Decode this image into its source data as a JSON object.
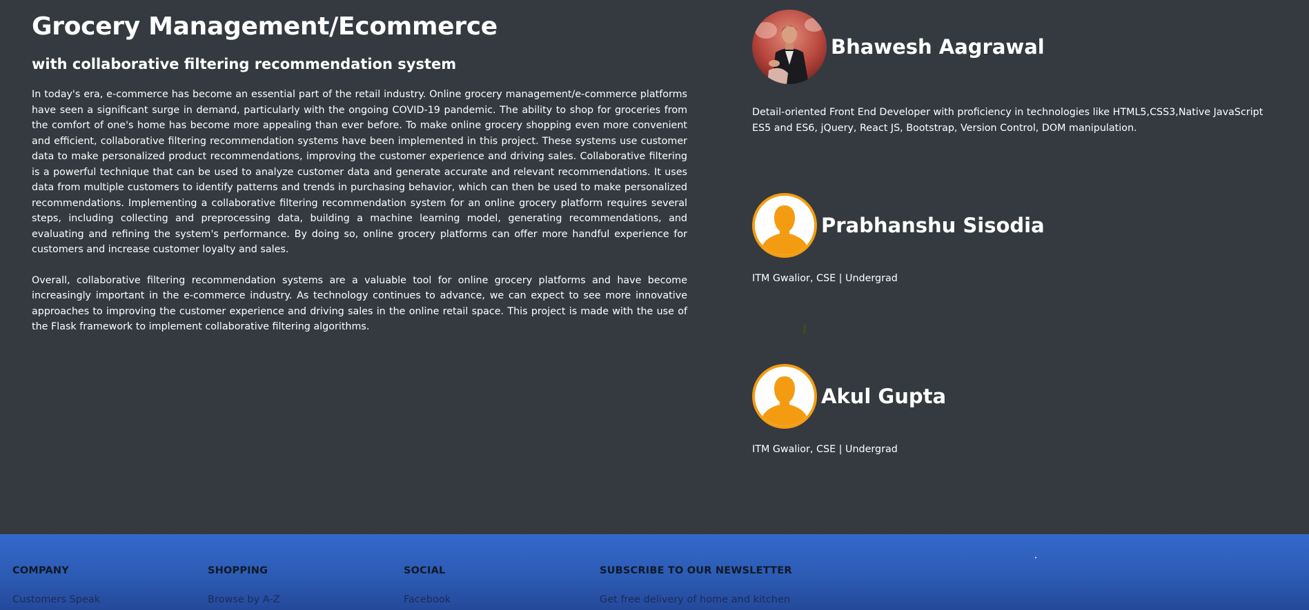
{
  "intro": {
    "title": "Grocery Management/Ecommerce",
    "subtitle": "with collaborative filtering recommendation system",
    "paragraph1": "In today's era, e-commerce has become an essential part of the retail industry. Online grocery management/e-commerce platforms have seen a significant surge in demand, particularly with the ongoing COVID-19 pandemic. The ability to shop for groceries from the comfort of one's home has become more appealing than ever before. To make online grocery shopping even more convenient and efficient, collaborative filtering recommendation systems have been implemented in this project. These systems use customer data to make personalized product recommendations, improving the customer experience and driving sales. Collaborative filtering is a powerful technique that can be used to analyze customer data and generate accurate and relevant recommendations. It uses data from multiple customers to identify patterns and trends in purchasing behavior, which can then be used to make personalized recommendations. Implementing a collaborative filtering recommendation system for an online grocery platform requires several steps, including collecting and preprocessing data, building a machine learning model, generating recommendations, and evaluating and refining the system's performance. By doing so, online grocery platforms can offer more handful experience for customers and increase customer loyalty and sales.",
    "paragraph2": "Overall, collaborative filtering recommendation systems are a valuable tool for online grocery platforms and have become increasingly important in the e-commerce industry. As technology continues to advance, we can expect to see more innovative approaches to improving the customer experience and driving sales in the online retail space. This project is made with the use of the Flask framework to implement collaborative filtering algorithms."
  },
  "team": [
    {
      "name": "Bhawesh Aagrawal",
      "description": "Detail-oriented Front End Developer with proficiency in technologies like HTML5,CSS3,Native JavaScript ES5 and ES6, jQuery, React JS, Bootstrap, Version Control, DOM manipulation.",
      "avatar": "profile-photo"
    },
    {
      "name": "Prabhanshu Sisodia",
      "description": "ITM Gwalior, CSE | Undergrad",
      "avatar": "default-user-icon"
    },
    {
      "name": "Akul Gupta",
      "description": "ITM Gwalior, CSE | Undergrad",
      "avatar": "default-user-icon"
    }
  ],
  "footer": {
    "columns": [
      {
        "heading": "COMPANY",
        "first_link": "Customers Speak"
      },
      {
        "heading": "SHOPPING",
        "first_link": "Browse by A-Z"
      },
      {
        "heading": "SOCIAL",
        "first_link": "Facebook"
      },
      {
        "heading": "SUBSCRIBE TO OUR NEWSLETTER",
        "first_link": "Get free delivery of home and kitchen"
      }
    ]
  },
  "colors": {
    "page_background": "#343a40",
    "avatar_accent": "#f39c12",
    "footer_blue": "#2f62c4"
  }
}
